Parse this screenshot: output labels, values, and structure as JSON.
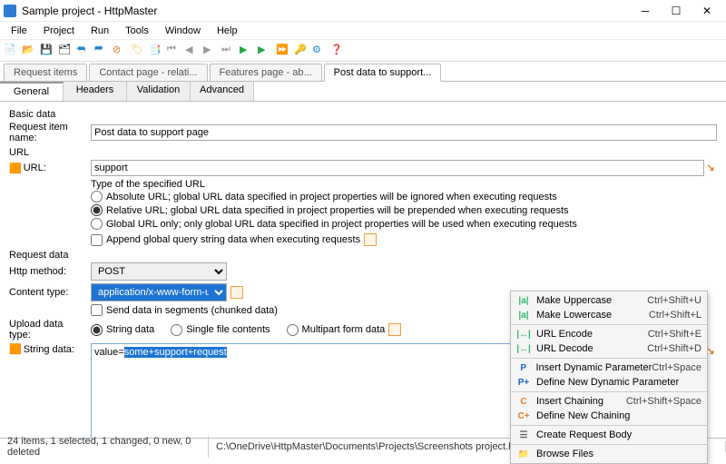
{
  "window": {
    "title": "Sample project - HttpMaster"
  },
  "menu": [
    "File",
    "Project",
    "Run",
    "Tools",
    "Window",
    "Help"
  ],
  "filetabs": [
    {
      "label": "Request items"
    },
    {
      "label": "Contact page - relati..."
    },
    {
      "label": "Features page - ab..."
    },
    {
      "label": "Post data to support..."
    }
  ],
  "activeFileTab": 3,
  "subtabs": [
    "General",
    "Headers",
    "Validation",
    "Advanced"
  ],
  "activeSubtab": 0,
  "groups": {
    "basic": "Basic data",
    "url": "URL",
    "request": "Request data"
  },
  "labels": {
    "requestItemName": "Request item name:",
    "url": "URL:",
    "typeOfUrl": "Type of the specified URL",
    "absUrl": "Absolute URL; global URL data specified in project properties will be ignored when executing requests",
    "relUrl": "Relative URL; global URL data specified in project properties will be prepended when executing requests",
    "globUrl": "Global URL only; only global URL data specified in project properties will be used when executing requests",
    "appendQS": "Append global query string data when executing requests",
    "httpMethod": "Http method:",
    "contentType": "Content type:",
    "chunked": "Send data in segments (chunked data)",
    "uploadType": "Upload data type:",
    "stringData": "String data",
    "singleFile": "Single file contents",
    "multipart": "Multipart form data",
    "stringDataLbl": "String data:"
  },
  "values": {
    "requestItemName": "Post data to support page",
    "url": "support",
    "httpMethod": "POST",
    "contentType": "application/x-www-form-urlencoded",
    "stringDataPrefix": "value=",
    "stringDataSel": "some+support+request"
  },
  "context": [
    {
      "ico": "|a|",
      "c": "#35b46b",
      "txt": "Make Uppercase",
      "sc": "Ctrl+Shift+U"
    },
    {
      "ico": "|a|",
      "c": "#35b46b",
      "txt": "Make Lowercase",
      "sc": "Ctrl+Shift+L"
    },
    {
      "sep": true
    },
    {
      "ico": "|↔|",
      "c": "#35b46b",
      "txt": "URL Encode",
      "sc": "Ctrl+Shift+E"
    },
    {
      "ico": "|↔|",
      "c": "#35b46b",
      "txt": "URL Decode",
      "sc": "Ctrl+Shift+D"
    },
    {
      "sep": true
    },
    {
      "ico": "P",
      "c": "#1e66d0",
      "txt": "Insert Dynamic Parameter",
      "sc": "Ctrl+Space"
    },
    {
      "ico": "P+",
      "c": "#1e66d0",
      "txt": "Define New Dynamic Parameter",
      "sc": ""
    },
    {
      "sep": true
    },
    {
      "ico": "C",
      "c": "#e67e22",
      "txt": "Insert Chaining",
      "sc": "Ctrl+Shift+Space"
    },
    {
      "ico": "C+",
      "c": "#e67e22",
      "txt": "Define New Chaining",
      "sc": ""
    },
    {
      "sep": true
    },
    {
      "ico": "☰",
      "c": "#666",
      "txt": "Create Request Body",
      "sc": ""
    },
    {
      "sep": true
    },
    {
      "ico": "📁",
      "c": "#666",
      "txt": "Browse Files",
      "sc": ""
    }
  ],
  "status": {
    "left": "24 items, 1 selected, 1 changed, 0 new, 0 deleted",
    "path": "C:\\OneDrive\\HttpMaster\\Documents\\Projects\\Screenshots project.hmpr"
  }
}
